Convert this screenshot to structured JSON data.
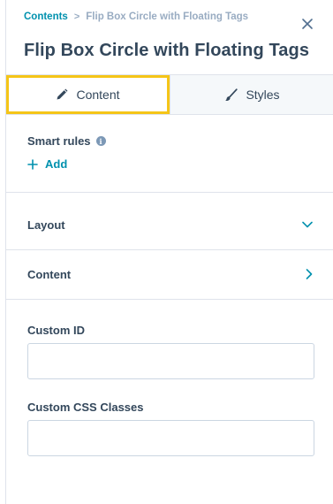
{
  "breadcrumb": {
    "root": "Contents",
    "separator": ">",
    "current": "Flip Box Circle with Floating Tags"
  },
  "title": "Flip Box Circle with Floating Tags",
  "tabs": [
    {
      "label": "Content",
      "icon": "pencil-icon",
      "active": true
    },
    {
      "label": "Styles",
      "icon": "brush-icon",
      "active": false
    }
  ],
  "smart_rules": {
    "label": "Smart rules",
    "info_glyph": "i",
    "add_label": "Add"
  },
  "sections": [
    {
      "label": "Layout",
      "icon": "chevron-down-icon"
    },
    {
      "label": "Content",
      "icon": "chevron-right-icon"
    }
  ],
  "fields": {
    "custom_id": {
      "label": "Custom ID",
      "value": "",
      "placeholder": ""
    },
    "custom_css": {
      "label": "Custom CSS Classes",
      "value": "",
      "placeholder": ""
    }
  },
  "colors": {
    "accent": "#0091ae",
    "text": "#33475b",
    "highlight": "#f5c518",
    "border": "#dfe3eb"
  }
}
